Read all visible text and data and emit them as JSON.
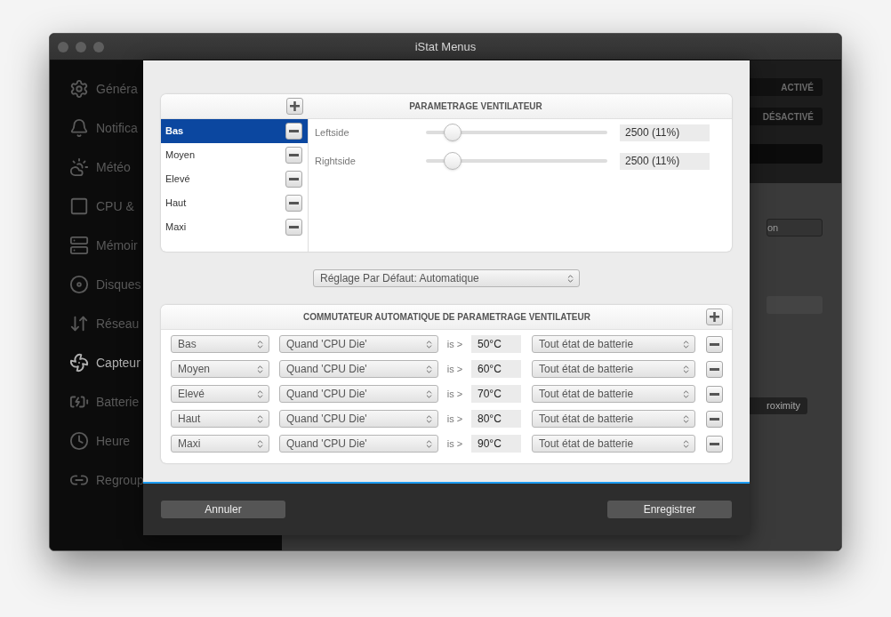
{
  "window": {
    "title": "iStat Menus"
  },
  "sidebar": {
    "items": [
      {
        "label": "Généra",
        "selected": false
      },
      {
        "label": "Notifica",
        "selected": false
      },
      {
        "label": "Météo",
        "selected": false
      },
      {
        "label": "CPU &",
        "selected": false
      },
      {
        "label": "Mémoir",
        "selected": false
      },
      {
        "label": "Disques",
        "selected": false
      },
      {
        "label": "Réseau",
        "selected": false
      },
      {
        "label": "Capteur",
        "selected": true
      },
      {
        "label": "Batterie",
        "selected": false
      },
      {
        "label": "Heure",
        "selected": false
      },
      {
        "label": "Regroup",
        "selected": false
      }
    ]
  },
  "background": {
    "top_buttons": [
      "ACTIVÉ",
      "DÉSACTIVÉ"
    ],
    "field_text": "on",
    "button_text": "roximity"
  },
  "dialog": {
    "profiles": {
      "title": "PARAMETRAGE VENTILATEUR",
      "items": [
        {
          "label": "Bas",
          "selected": true
        },
        {
          "label": "Moyen",
          "selected": false
        },
        {
          "label": "Elevé",
          "selected": false
        },
        {
          "label": "Haut",
          "selected": false
        },
        {
          "label": "Maxi",
          "selected": false
        }
      ]
    },
    "fans": [
      {
        "name": "Leftside",
        "level": 0.11,
        "value": "2500 (11%)"
      },
      {
        "name": "Rightside",
        "level": 0.11,
        "value": "2500 (11%)"
      }
    ],
    "default_select": "Réglage Par Défaut: Automatique",
    "switcher": {
      "title": "COMMUTATEUR AUTOMATIQUE DE PARAMETRAGE VENTILATEUR",
      "rows": [
        {
          "profile": "Bas",
          "sensor": "Quand 'CPU Die'",
          "comparator": "is >",
          "threshold": "50°C",
          "battery": "Tout état de batterie"
        },
        {
          "profile": "Moyen",
          "sensor": "Quand 'CPU Die'",
          "comparator": "is >",
          "threshold": "60°C",
          "battery": "Tout état de batterie"
        },
        {
          "profile": "Elevé",
          "sensor": "Quand 'CPU Die'",
          "comparator": "is >",
          "threshold": "70°C",
          "battery": "Tout état de batterie"
        },
        {
          "profile": "Haut",
          "sensor": "Quand 'CPU Die'",
          "comparator": "is >",
          "threshold": "80°C",
          "battery": "Tout état de batterie"
        },
        {
          "profile": "Maxi",
          "sensor": "Quand 'CPU Die'",
          "comparator": "is >",
          "threshold": "90°C",
          "battery": "Tout état de batterie"
        }
      ]
    },
    "buttons": {
      "cancel": "Annuler",
      "save": "Enregistrer"
    }
  }
}
